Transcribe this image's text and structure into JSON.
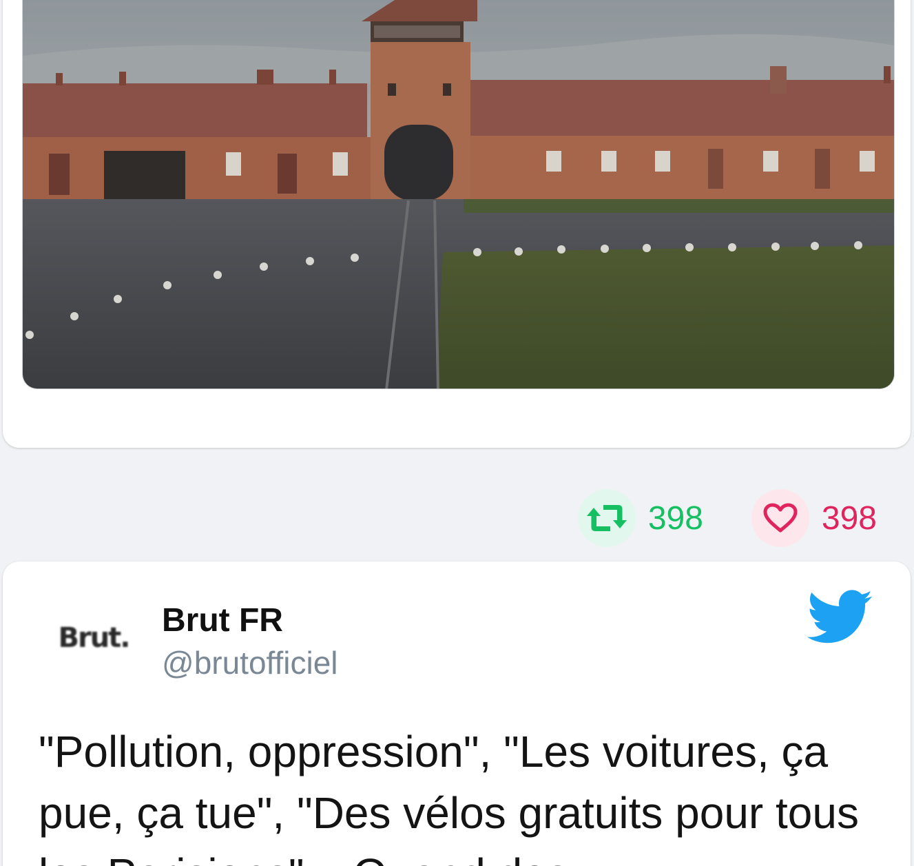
{
  "previous_tweet": {
    "retweet_count": "398",
    "like_count": "398"
  },
  "tweet": {
    "author_name": "Brut FR",
    "author_handle": "@brutofficiel",
    "avatar_text": "Brut.",
    "text": "\"Pollution, oppression\", \"Les voitures, ça pue, ça tue\", \"Des vélos gratuits pour tous les Parisiens\"... Quand des"
  },
  "colors": {
    "retweet": "#17bf63",
    "like": "#e0245e",
    "twitter_blue": "#1da1f2"
  },
  "icons": {
    "retweet": "retweet-icon",
    "like": "heart-icon",
    "brand": "twitter-bird-icon"
  }
}
